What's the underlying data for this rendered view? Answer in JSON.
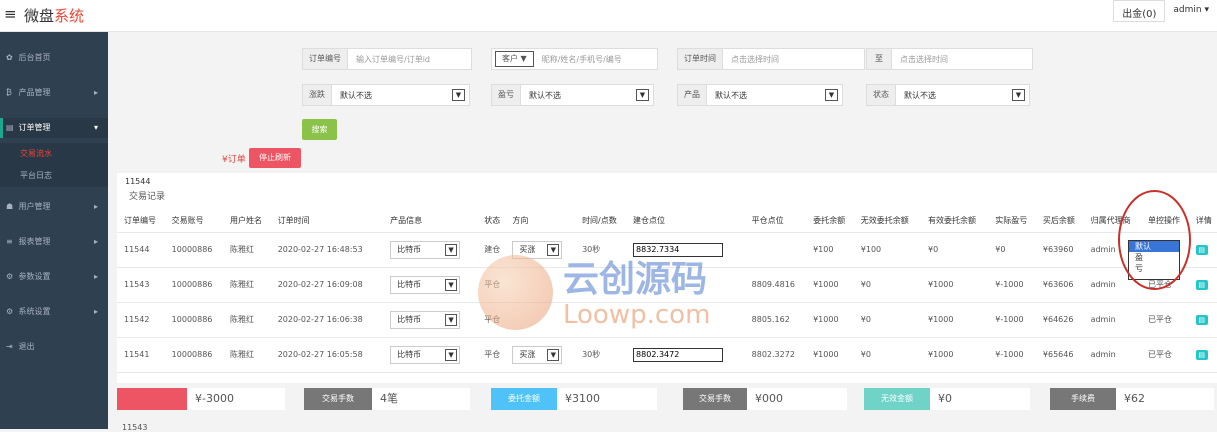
{
  "app": {
    "menu_icon": "hamburger-icon",
    "title_main": "微盘",
    "title_accent": "系统"
  },
  "topbar": {
    "out_label": "出金(0)",
    "user": "admin",
    "user_caret": "▾"
  },
  "sidebar": {
    "items": [
      {
        "icon": "home-icon",
        "glyph": "✿",
        "label": "后台首页"
      },
      {
        "icon": "bitcoin-icon",
        "glyph": "₿",
        "label": "产品管理",
        "arrow": "▸"
      },
      {
        "icon": "order-icon",
        "glyph": "▤",
        "label": "订单管理",
        "arrow": "▾"
      },
      {
        "icon": "user-icon",
        "glyph": "☗",
        "label": "用户管理",
        "arrow": "▸"
      },
      {
        "icon": "report-icon",
        "glyph": "≡",
        "label": "报表管理",
        "arrow": "▸"
      },
      {
        "icon": "gear-icon",
        "glyph": "⚙",
        "label": "参数设置",
        "arrow": "▸"
      },
      {
        "icon": "gears-icon",
        "glyph": "⚙",
        "label": "系统设置",
        "arrow": "▸"
      },
      {
        "icon": "logout-icon",
        "glyph": "⇥",
        "label": "退出"
      }
    ],
    "sub_items": [
      {
        "label": "交易流水"
      },
      {
        "label": "平台日志"
      }
    ]
  },
  "filters": {
    "order_no": {
      "label": "订单编号",
      "placeholder": "输入订单编号/订单id"
    },
    "customer": {
      "select": "客户",
      "placeholder": "昵称/姓名/手机号/编号"
    },
    "order_time": {
      "label": "订单时间",
      "placeholder": "点击选择时间"
    },
    "to": {
      "label": "至",
      "placeholder": "点击选择时间"
    },
    "updown": {
      "label": "涨跌",
      "value": "默认不选"
    },
    "profit": {
      "label": "盈亏",
      "value": "默认不选"
    },
    "product": {
      "label": "产品",
      "value": "默认不选"
    },
    "status": {
      "label": "状态",
      "value": "默认不选"
    },
    "dropdown_glyph": "▼",
    "search_button": "搜索"
  },
  "order_controls": {
    "tag": "¥订单",
    "stop_refresh": "停止刷新"
  },
  "panel": {
    "id": "11544",
    "title": "交易记录"
  },
  "table": {
    "headers": [
      "订单编号",
      "交易账号",
      "用户姓名",
      "订单时间",
      "产品信息",
      "状态",
      "方向",
      "时间/点数",
      "建仓点位",
      "平仓点位",
      "委托余额",
      "无效委托余额",
      "有效委托余额",
      "实际盈亏",
      "买后余额",
      "归属代理商",
      "单控操作",
      "详情"
    ],
    "rows": [
      {
        "id": "11544",
        "account": "10000886",
        "name": "陈雅红",
        "time": "2020-02-27 16:48:53",
        "product": "比特币",
        "status": "建仓",
        "direction": "买涨",
        "period": "30秒",
        "open": "8832.7334",
        "close": "",
        "entrust": "¥100",
        "invalid": "¥100",
        "valid": "¥0",
        "pl": "¥0",
        "after": "¥63960",
        "agent": "admin",
        "ctl": "",
        "detail": "▤"
      },
      {
        "id": "11543",
        "account": "10000886",
        "name": "陈雅红",
        "time": "2020-02-27 16:09:08",
        "product": "比特币",
        "status": "平仓",
        "direction": "",
        "period": "",
        "open": "",
        "close": "8809.4816",
        "entrust": "¥1000",
        "invalid": "¥0",
        "valid": "¥1000",
        "pl": "¥-1000",
        "after": "¥63606",
        "agent": "admin",
        "ctl": "已平仓",
        "detail": "▤"
      },
      {
        "id": "11542",
        "account": "10000886",
        "name": "陈雅红",
        "time": "2020-02-27 16:06:38",
        "product": "比特币",
        "status": "平仓",
        "direction": "",
        "period": "",
        "open": "",
        "close": "8805.162",
        "entrust": "¥1000",
        "invalid": "¥0",
        "valid": "¥1000",
        "pl": "¥-1000",
        "after": "¥64626",
        "agent": "admin",
        "ctl": "已平仓",
        "detail": "▤"
      },
      {
        "id": "11541",
        "account": "10000886",
        "name": "陈雅红",
        "time": "2020-02-27 16:05:58",
        "product": "比特币",
        "status": "平仓",
        "direction": "买涨",
        "period": "30秒",
        "open": "8802.3472",
        "close": "8802.3272",
        "entrust": "¥1000",
        "invalid": "¥0",
        "valid": "¥1000",
        "pl": "¥-1000",
        "after": "¥65646",
        "agent": "admin",
        "ctl": "已平仓",
        "detail": "▤"
      }
    ],
    "ctl_options": [
      "默认",
      "盈",
      "亏"
    ]
  },
  "summary": [
    {
      "label": "",
      "value": "¥-3000",
      "color": "#ed5565"
    },
    {
      "label": "交易手数",
      "value": "4笔",
      "color": "#777777"
    },
    {
      "label": "委托金额",
      "value": "¥3100",
      "color": "#4fc3f7"
    },
    {
      "label": "交易手数",
      "value": "¥000",
      "color": "#777777"
    },
    {
      "label": "无效金额",
      "value": "¥0",
      "color": "#6fd3c8"
    },
    {
      "label": "手续费",
      "value": "¥62",
      "color": "#777777"
    }
  ],
  "watermark": {
    "cn": "云创源码",
    "en": "Loowp.com"
  },
  "bottom": {
    "id": "11543"
  },
  "colors": {
    "sidebar": "#2f4050",
    "accent_red": "#e8473a",
    "green": "#1ab394",
    "search_btn": "#8bc34a",
    "stop_btn": "#ed5565"
  }
}
